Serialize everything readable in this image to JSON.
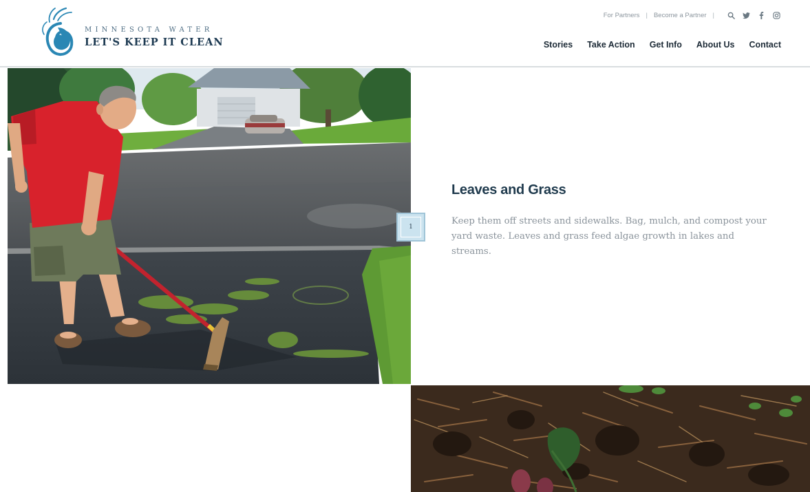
{
  "header": {
    "logo": {
      "line1": "MINNESOTA WATER",
      "line2": "LET'S KEEP IT CLEAN"
    },
    "utility": {
      "links": [
        "For Partners",
        "Become a Partner"
      ],
      "separator": "|",
      "icons": [
        "search-icon",
        "twitter-icon",
        "facebook-icon",
        "instagram-icon"
      ]
    },
    "nav": [
      "Stories",
      "Take Action",
      "Get Info",
      "About Us",
      "Contact"
    ]
  },
  "feature": {
    "title": "Leaves and Grass",
    "body": "Keep them off streets and sidewalks. Bag, mulch, and compost your yard waste. Leaves and grass feed algae growth in lakes and streams.",
    "slide_number": "1"
  },
  "colors": {
    "brand_navy": "#1f3a4d",
    "brand_blue": "#2a87b4",
    "slide_badge": "#cbe3ef",
    "body_text": "#8a939b"
  }
}
